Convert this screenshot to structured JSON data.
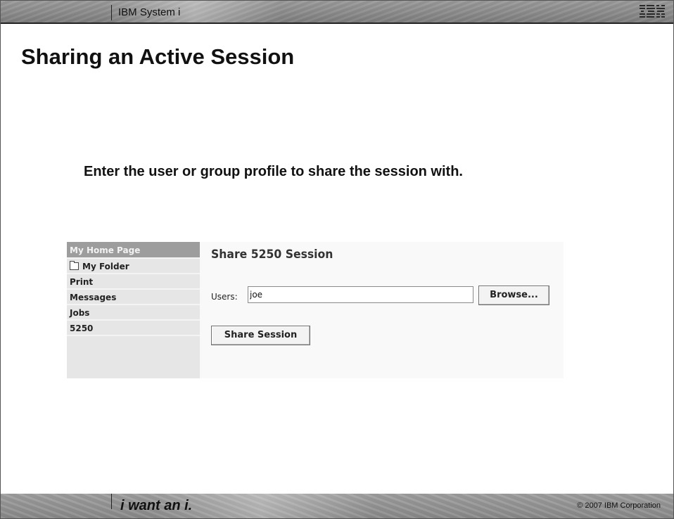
{
  "header": {
    "brand": "IBM System i",
    "logo_text": "IBM"
  },
  "slide": {
    "title": "Sharing an Active Session",
    "subtitle": "Enter the user or group profile to share the session with."
  },
  "app": {
    "sidebar": {
      "items": [
        {
          "label": "My Home Page",
          "icon": "",
          "active": true
        },
        {
          "label": "My Folder",
          "icon": "folder-icon",
          "active": false
        },
        {
          "label": "Print",
          "icon": "",
          "active": false
        },
        {
          "label": "Messages",
          "icon": "",
          "active": false
        },
        {
          "label": "Jobs",
          "icon": "",
          "active": false
        },
        {
          "label": "5250",
          "icon": "",
          "active": false
        }
      ]
    },
    "main": {
      "heading": "Share 5250 Session",
      "users_label": "Users:",
      "users_value": "joe",
      "browse_label": "Browse...",
      "share_label": "Share Session"
    }
  },
  "footer": {
    "tagline": "i want an i.",
    "copyright": "© 2007 IBM Corporation"
  },
  "colors": {
    "header_gray": "#8c8c8c",
    "sidebar_bg": "#e6e6e6",
    "active_item": "#9d9d9d"
  }
}
